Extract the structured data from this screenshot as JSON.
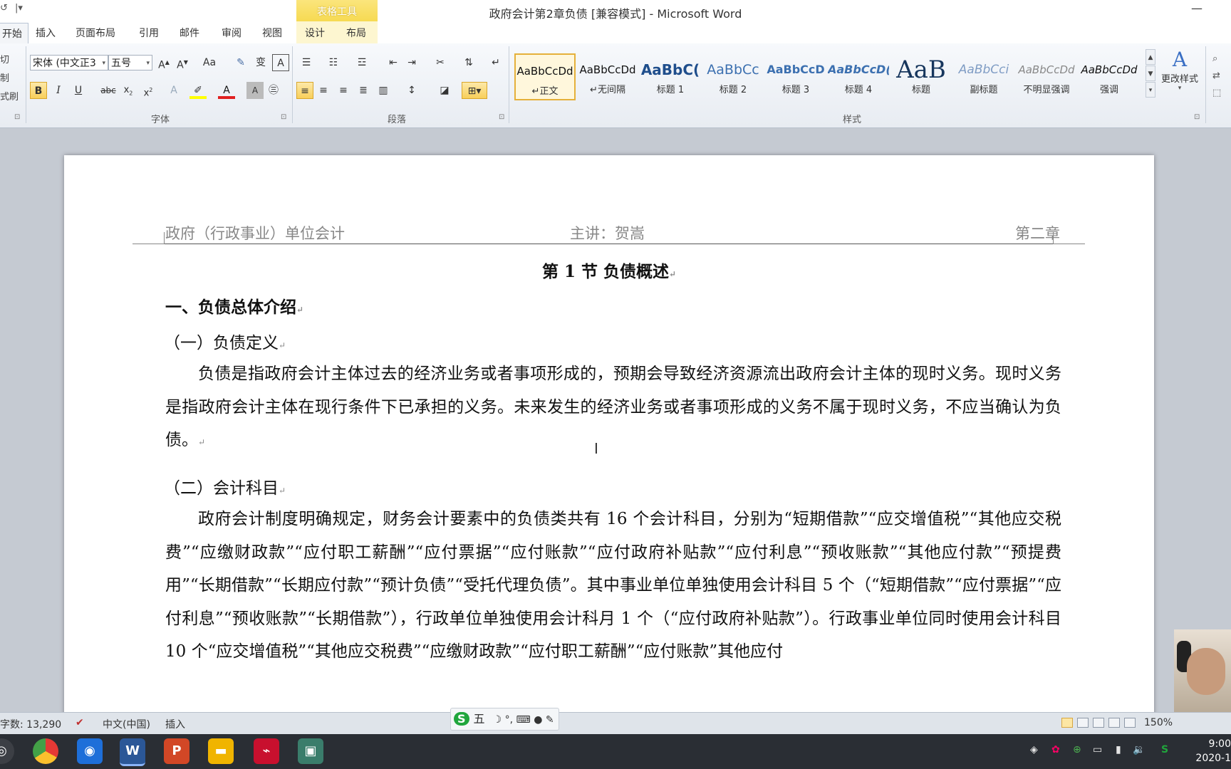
{
  "window": {
    "title": "政府会计第2章负债 [兼容模式] - Microsoft Word",
    "table_tools_label": "表格工具",
    "minimize_glyph": "—"
  },
  "qat": {
    "undo": "↺",
    "customize": "|▾"
  },
  "tabs": [
    {
      "label": "开始",
      "active": true
    },
    {
      "label": "插入"
    },
    {
      "label": "页面布局"
    },
    {
      "label": "引用"
    },
    {
      "label": "邮件"
    },
    {
      "label": "审阅"
    },
    {
      "label": "视图"
    },
    {
      "label": "设计"
    },
    {
      "label": "布局"
    }
  ],
  "clipboard": {
    "cut": "切",
    "copy": "制",
    "format_painter": "式刷"
  },
  "font": {
    "name": "宋体 (中文正3",
    "size": "五号",
    "group_label": "字体"
  },
  "paragraph": {
    "group_label": "段落"
  },
  "styles": {
    "group_label": "样式",
    "change_styles_label": "更改样式",
    "items": [
      {
        "sample": "AaBbCcDd",
        "name": "↵正文",
        "selected": true
      },
      {
        "sample": "AaBbCcDd",
        "name": "↵无间隔"
      },
      {
        "sample": "AaBbC(",
        "name": "标题 1"
      },
      {
        "sample": "AaBbCc",
        "name": "标题 2"
      },
      {
        "sample": "AaBbCcD",
        "name": "标题 3"
      },
      {
        "sample": "AaBbCcD(",
        "name": "标题 4"
      },
      {
        "sample": "AaB",
        "name": "标题"
      },
      {
        "sample": "AaBbCci",
        "name": "副标题"
      },
      {
        "sample": "AaBbCcDd",
        "name": "不明显强调"
      },
      {
        "sample": "AaBbCcDd",
        "name": "强调"
      }
    ]
  },
  "document": {
    "header_left": "政府（行政事业）单位会计",
    "header_center": "主讲：贺嵩",
    "header_right": "第二章",
    "heading": "第 1 节  负债概述",
    "section1": "一、负债总体介绍",
    "sub1": "（一）负债定义",
    "para1": "负债是指政府会计主体过去的经济业务或者事项形成的，预期会导致经济资源流出政府会计主体的现时义务。现时义务是指政府会计主体在现行条件下已承担的义务。未来发生的经济业务或者事项形成的义务不属于现时义务，不应当确认为负债。",
    "sub2": "（二）会计科目",
    "para2": "政府会计制度明确规定，财务会计要素中的负债类共有 16 个会计科目，分别为“短期借款”“应交增值税”“其他应交税费”“应缴财政款”“应付职工薪酬”“应付票据”“应付账款”“应付政府补贴款”“应付利息”“预收账款”“其他应付款”“预提费用”“长期借款”“长期应付款”“预计负债”“受托代理负债”。其中事业单位单独使用会计科目 5 个（“短期借款”“应付票据”“应付利息”“预收账款”“长期借款”），行政单位单独使用会计科月 1 个（“应付政府补贴款”）。行政事业单位同时使用会计科目 10 个“应交增值税”“其他应交税费”“应缴财政款”“应付职工薪酬”“应付账款”其他应付"
  },
  "status": {
    "word_count": "字数: 13,290",
    "language": "中文(中国)",
    "mode": "插入",
    "zoom": "150%"
  },
  "ime": {
    "logo": "S",
    "mode": "五",
    "icons": "☽ °, ⌨ ● ✎"
  },
  "taskbar": {
    "time": "9:00",
    "date": "2020-1"
  }
}
